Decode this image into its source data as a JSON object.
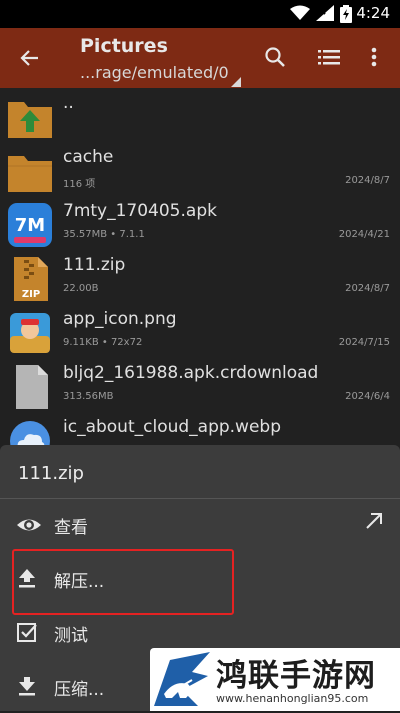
{
  "status_bar": {
    "time": "4:24"
  },
  "app_bar": {
    "title": "Pictures",
    "path": "...rage/emulated/0"
  },
  "files": [
    {
      "name": "..",
      "meta": "",
      "date": "",
      "icon": "folder-up-icon"
    },
    {
      "name": "cache",
      "meta": "116 项",
      "date": "2024/8/7",
      "icon": "folder-icon"
    },
    {
      "name": "7mty_170405.apk",
      "meta": "35.57MB  •  7.1.1",
      "date": "2024/4/21",
      "icon": "apk-app-icon"
    },
    {
      "name": "111.zip",
      "meta": "22.00B",
      "date": "2024/8/7",
      "icon": "zip-file-icon"
    },
    {
      "name": "app_icon.png",
      "meta": "9.11KB  •  72x72",
      "date": "2024/7/15",
      "icon": "image-thumbnail-icon"
    },
    {
      "name": "bljq2_161988.apk.crdownload",
      "meta": "313.56MB",
      "date": "2024/6/4",
      "icon": "generic-file-icon"
    },
    {
      "name": "ic_about_cloud_app.webp",
      "meta": "",
      "date": "",
      "icon": "cloud-image-icon"
    }
  ],
  "sheet": {
    "title": "111.zip",
    "items": [
      {
        "label": "查看",
        "icon": "eye-icon"
      },
      {
        "label": "解压...",
        "icon": "extract-icon"
      },
      {
        "label": "测试",
        "icon": "checkbox-icon"
      },
      {
        "label": "压缩...",
        "icon": "compress-icon"
      }
    ]
  },
  "watermark": {
    "title": "鸿联手游网",
    "url": "www.henanhonglian95.com"
  },
  "colors": {
    "app_bar": "#7e2a14",
    "background": "#212121",
    "sheet": "#3c3c3c",
    "folder": "#c4842c",
    "highlight": "#e52222"
  }
}
